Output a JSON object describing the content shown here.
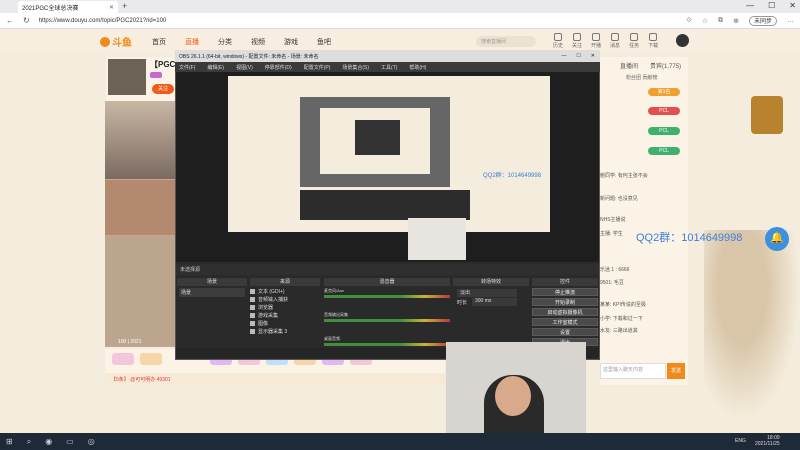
{
  "browser": {
    "tab_title": "2021PGC全球总决赛",
    "url": "https://www.douyu.com/topic/PGC2021?rid=100",
    "sync_label": "未同步"
  },
  "site": {
    "logo": "斗鱼",
    "nav": [
      "首页",
      "直播",
      "分类",
      "视频",
      "游戏",
      "鱼吧"
    ],
    "search_placeholder": "搜索直播间",
    "header_icons": [
      "历史",
      "关注",
      "开播",
      "消息",
      "任务",
      "下载"
    ]
  },
  "room": {
    "title": "【PGC",
    "follow": "关注",
    "timestamp": "100 | 2021",
    "bottom_text": "【5条】 @可可明办 49301"
  },
  "chat": {
    "tabs": [
      "直播间",
      "贵宾(1,775)"
    ],
    "online": "粉丝团 贡献榜",
    "ranks": [
      "第1名",
      "PCL",
      "PCL",
      "PCL"
    ],
    "lines": [
      "鲍同学: 有何主张不会",
      "新问题: 也没意见",
      "NHS主播说",
      "主播: 学生",
      "QQ2群: 1014649998",
      "乐迷 1 : 6666",
      "9501: 毛豆",
      "某某: KPI传说的至极",
      "小学: 下载和过一下",
      "水友: 三路出道其"
    ],
    "input_placeholder": "这里输入聊天内容",
    "send": "发送"
  },
  "qq": {
    "small": "QQ2群：1014649998",
    "big": "QQ2群：1014649998"
  },
  "obs": {
    "title": "OBS 26.1.1 (64-bit, windows) - 配置文件: 未命名 - 场景: 未命名",
    "menu": [
      "文件(F)",
      "编辑(E)",
      "视图(V)",
      "停靠部件(D)",
      "配置文件(P)",
      "场景集合(S)",
      "工具(T)",
      "帮助(H)"
    ],
    "status_line": "未选择源",
    "dock_scenes": "场景",
    "dock_sources": "来源",
    "dock_mixer": "混音器",
    "dock_transitions": "转场特效",
    "dock_controls": "控件",
    "scene_item": "场景",
    "sources": [
      "文本 (GDI+)",
      "音频输入捕获",
      "浏览器",
      "游戏采集",
      "图像",
      "显示器采集 3"
    ],
    "mixer": [
      "麦克风/Aux",
      "音频输出采集",
      "桌面音频"
    ],
    "transition": "淡出",
    "duration_label": "时长",
    "duration": "300 ms",
    "controls": [
      "停止推流",
      "开始录制",
      "启动虚拟摄像机",
      "工作室模式",
      "设置",
      "退出"
    ]
  },
  "taskbar": {
    "lang": "ENG",
    "time": "18:09",
    "date": "2021/11/25"
  }
}
